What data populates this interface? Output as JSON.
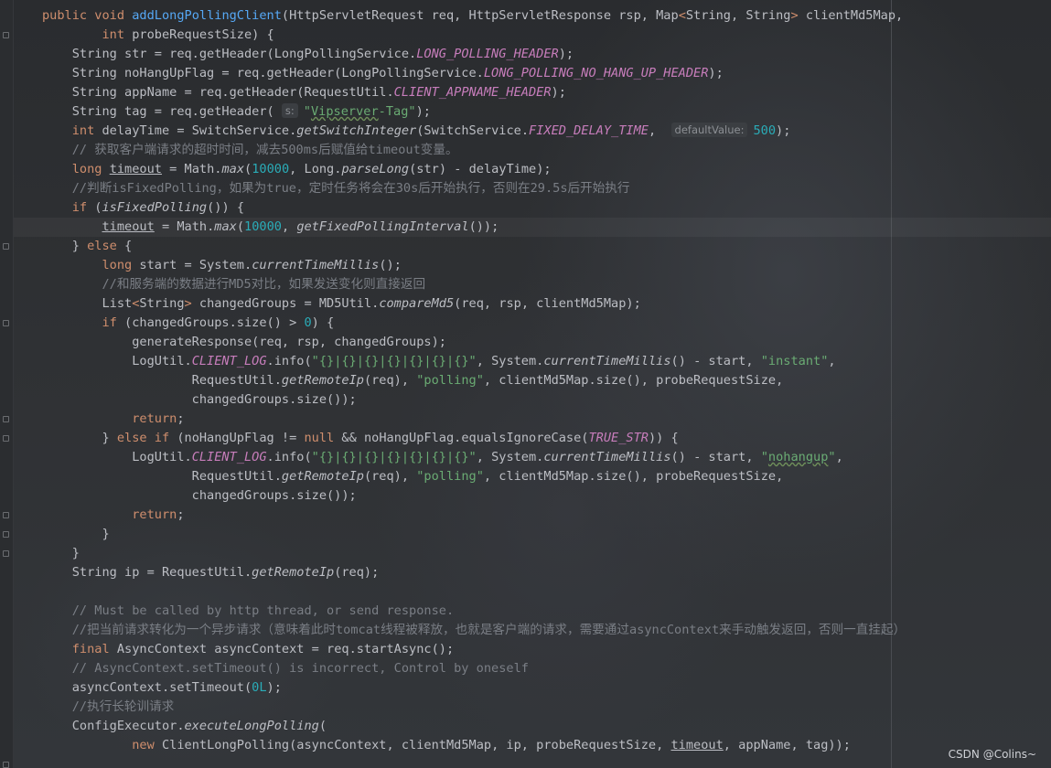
{
  "editor": {
    "lines": [
      [
        [
          "public",
          "kw"
        ],
        [
          " "
        ],
        [
          "void",
          "kw"
        ],
        [
          " "
        ],
        [
          "addLongPollingClient",
          "fn"
        ],
        [
          "(HttpServletRequest req, HttpServletResponse rsp, Map"
        ],
        [
          "<",
          "kw"
        ],
        [
          "String, String"
        ],
        [
          ">",
          "kw"
        ],
        [
          " clientMd5Map,"
        ]
      ],
      [
        [
          "        "
        ],
        [
          "int",
          "kw"
        ],
        [
          " probeRequestSize) {"
        ]
      ],
      [
        [
          "    String str = req.getHeader(LongPollingService."
        ],
        [
          "LONG_POLLING_HEADER",
          "st"
        ],
        [
          ");"
        ]
      ],
      [
        [
          "    String noHangUpFlag = req.getHeader(LongPollingService."
        ],
        [
          "LONG_POLLING_NO_HANG_UP_HEADER",
          "st"
        ],
        [
          ");"
        ]
      ],
      [
        [
          "    String appName = req.getHeader(RequestUtil."
        ],
        [
          "CLIENT_APPNAME_HEADER",
          "st"
        ],
        [
          ");"
        ]
      ],
      [
        [
          "    String tag = req.getHeader( "
        ],
        [
          "s:",
          "hint"
        ],
        [
          "\"",
          "str"
        ],
        [
          "Vipserver",
          "str sq"
        ],
        [
          "-Tag\"",
          "str"
        ],
        [
          ");"
        ]
      ],
      [
        [
          "    "
        ],
        [
          "int",
          "kw"
        ],
        [
          " delayTime = SwitchService."
        ],
        [
          "getSwitchInteger",
          "sm"
        ],
        [
          "(SwitchService."
        ],
        [
          "FIXED_DELAY_TIME",
          "st"
        ],
        [
          ",  "
        ],
        [
          "defaultValue:",
          "hint"
        ],
        [
          "500",
          "num"
        ],
        [
          ");"
        ]
      ],
      [
        [
          "    // 获取客户端请求的超时时间，减去500ms后赋值给timeout变量。",
          "cm"
        ]
      ],
      [
        [
          "    "
        ],
        [
          "long",
          "kw"
        ],
        [
          " "
        ],
        [
          "timeout",
          "ul"
        ],
        [
          " = Math."
        ],
        [
          "max",
          "sm"
        ],
        [
          "("
        ],
        [
          "10000",
          "num"
        ],
        [
          ", Long."
        ],
        [
          "parseLong",
          "sm"
        ],
        [
          "(str) - delayTime);"
        ]
      ],
      [
        [
          "    //判断isFixedPolling，如果为true，定时任务将会在30s后开始执行，否则在29.5s后开始执行",
          "cm"
        ]
      ],
      [
        [
          "    "
        ],
        [
          "if",
          "kw"
        ],
        [
          " ("
        ],
        [
          "isFixedPolling",
          "sm"
        ],
        [
          "()) {"
        ]
      ],
      [
        [
          "        "
        ],
        [
          "timeout",
          "ul"
        ],
        [
          " = Math."
        ],
        [
          "max",
          "sm"
        ],
        [
          "("
        ],
        [
          "10000",
          "num"
        ],
        [
          ", "
        ],
        [
          "getFixedPollingInterval",
          "sm"
        ],
        [
          "());"
        ]
      ],
      [
        [
          "    } "
        ],
        [
          "else",
          "kw"
        ],
        [
          " {"
        ]
      ],
      [
        [
          "        "
        ],
        [
          "long",
          "kw"
        ],
        [
          " start = System."
        ],
        [
          "currentTimeMillis",
          "sm"
        ],
        [
          "();"
        ]
      ],
      [
        [
          "        //和服务端的数据进行MD5对比，如果发送变化则直接返回",
          "cm"
        ]
      ],
      [
        [
          "        List"
        ],
        [
          "<",
          "kw"
        ],
        [
          "String"
        ],
        [
          ">",
          "kw"
        ],
        [
          " changedGroups = MD5Util."
        ],
        [
          "compareMd5",
          "sm"
        ],
        [
          "(req, rsp, clientMd5Map);"
        ]
      ],
      [
        [
          "        "
        ],
        [
          "if",
          "kw"
        ],
        [
          " (changedGroups.size() > "
        ],
        [
          "0",
          "num"
        ],
        [
          ") {"
        ]
      ],
      [
        [
          "            generateResponse(req, rsp, changedGroups);"
        ]
      ],
      [
        [
          "            LogUtil."
        ],
        [
          "CLIENT_LOG",
          "st"
        ],
        [
          ".info("
        ],
        [
          "\"{}|{}|{}|{}|{}|{}|{}\"",
          "str"
        ],
        [
          ", System."
        ],
        [
          "currentTimeMillis",
          "sm"
        ],
        [
          "() - start, "
        ],
        [
          "\"instant\"",
          "str"
        ],
        [
          ","
        ]
      ],
      [
        [
          "                    RequestUtil."
        ],
        [
          "getRemoteIp",
          "sm"
        ],
        [
          "(req), "
        ],
        [
          "\"polling\"",
          "str"
        ],
        [
          ", clientMd5Map.size(), probeRequestSize,"
        ]
      ],
      [
        [
          "                    changedGroups.size());"
        ]
      ],
      [
        [
          "            "
        ],
        [
          "return",
          "kw"
        ],
        [
          ";"
        ]
      ],
      [
        [
          "        } "
        ],
        [
          "else if",
          "kw"
        ],
        [
          " (noHangUpFlag != "
        ],
        [
          "null",
          "kw"
        ],
        [
          " && noHangUpFlag.equalsIgnoreCase("
        ],
        [
          "TRUE_STR",
          "st"
        ],
        [
          ")) {"
        ]
      ],
      [
        [
          "            LogUtil."
        ],
        [
          "CLIENT_LOG",
          "st"
        ],
        [
          ".info("
        ],
        [
          "\"{}|{}|{}|{}|{}|{}|{}\"",
          "str"
        ],
        [
          ", System."
        ],
        [
          "currentTimeMillis",
          "sm"
        ],
        [
          "() - start, "
        ],
        [
          "\"",
          "str"
        ],
        [
          "nohangup",
          "str sq"
        ],
        [
          "\"",
          "str"
        ],
        [
          ","
        ]
      ],
      [
        [
          "                    RequestUtil."
        ],
        [
          "getRemoteIp",
          "sm"
        ],
        [
          "(req), "
        ],
        [
          "\"polling\"",
          "str"
        ],
        [
          ", clientMd5Map.size(), probeRequestSize,"
        ]
      ],
      [
        [
          "                    changedGroups.size());"
        ]
      ],
      [
        [
          "            "
        ],
        [
          "return",
          "kw"
        ],
        [
          ";"
        ]
      ],
      [
        [
          "        }"
        ]
      ],
      [
        [
          "    }"
        ]
      ],
      [
        [
          "    String ip = RequestUtil."
        ],
        [
          "getRemoteIp",
          "sm"
        ],
        [
          "(req);"
        ]
      ],
      [
        [
          ""
        ]
      ],
      [
        [
          "    // Must be called by http thread, or send response.",
          "cm"
        ]
      ],
      [
        [
          "    //把当前请求转化为一个异步请求（意味着此时tomcat线程被释放，也就是客户端的请求，需要通过asyncContext来手动触发返回，否则一直挂起）",
          "cm"
        ]
      ],
      [
        [
          "    "
        ],
        [
          "final",
          "kw"
        ],
        [
          " AsyncContext asyncContext = req.startAsync();"
        ]
      ],
      [
        [
          "    // AsyncContext.setTimeout() is incorrect, Control by oneself",
          "cm"
        ]
      ],
      [
        [
          "    asyncContext.setTimeout("
        ],
        [
          "0L",
          "num"
        ],
        [
          ");"
        ]
      ],
      [
        [
          "    //执行长轮训请求",
          "cm"
        ]
      ],
      [
        [
          "    ConfigExecutor."
        ],
        [
          "executeLongPolling",
          "sm"
        ],
        [
          "("
        ]
      ],
      [
        [
          "            "
        ],
        [
          "new",
          "kw"
        ],
        [
          " ClientLongPolling(asyncContext, clientMd5Map, ip, probeRequestSize, "
        ],
        [
          "timeout",
          "ul"
        ],
        [
          ", appName, tag));"
        ]
      ]
    ]
  },
  "watermark": "CSDN @Colins~",
  "colors": {
    "keyword": "#cf8e6d",
    "function": "#56a8f5",
    "static_field": "#c77dbb",
    "string": "#6aab73",
    "number": "#2aacb8",
    "comment": "#7a7e85",
    "text": "#bcbec4"
  }
}
